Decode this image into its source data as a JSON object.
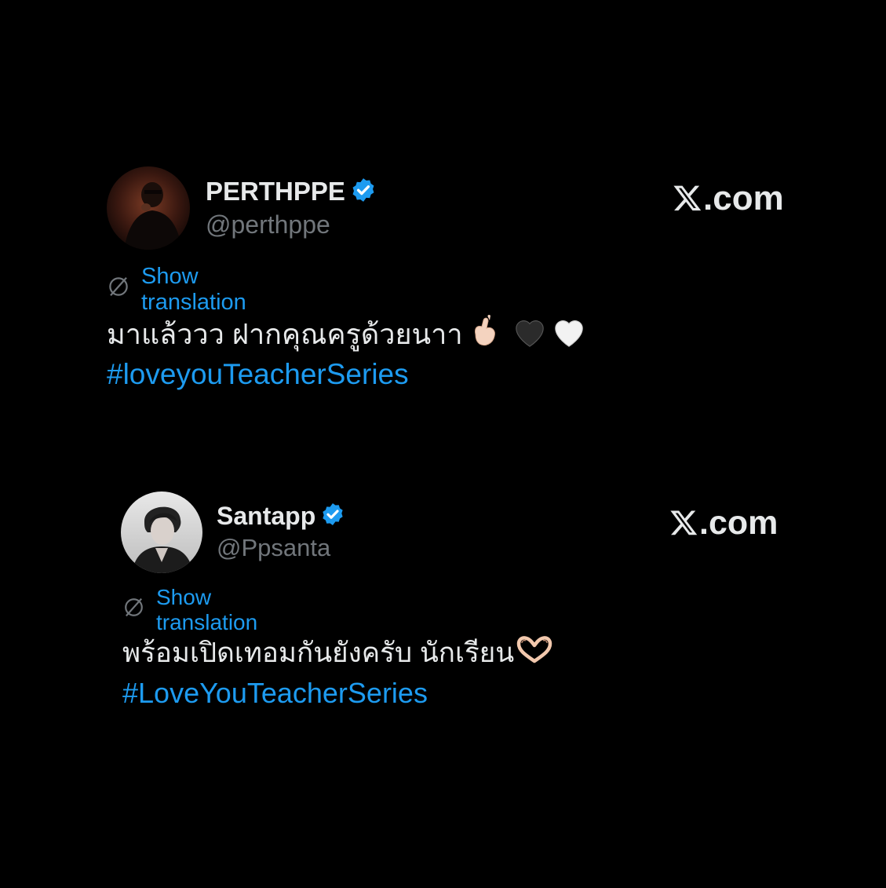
{
  "posts": [
    {
      "name": "PERTHPPE",
      "handle": "@perthppe",
      "site": ".com",
      "translate_label": "Show translation",
      "text": "มาแล้ววว ฝากคุณครูด้วยนาา",
      "emojis": [
        "finger-heart-icon",
        "black-heart-icon",
        "white-heart-icon"
      ],
      "hashtag": "#loveyouTeacherSeries"
    },
    {
      "name": "Santapp",
      "handle": "@Ppsanta",
      "site": ".com",
      "translate_label": "Show translation",
      "text": "พร้อมเปิดเทอมกันยังครับ นักเรียน",
      "emojis": [
        "heart-hands-icon"
      ],
      "hashtag": "#LoveYouTeacherSeries"
    }
  ],
  "colors": {
    "background": "#000000",
    "link": "#1d9bf0",
    "handle": "#71767b",
    "text": "#e7e9ea"
  }
}
